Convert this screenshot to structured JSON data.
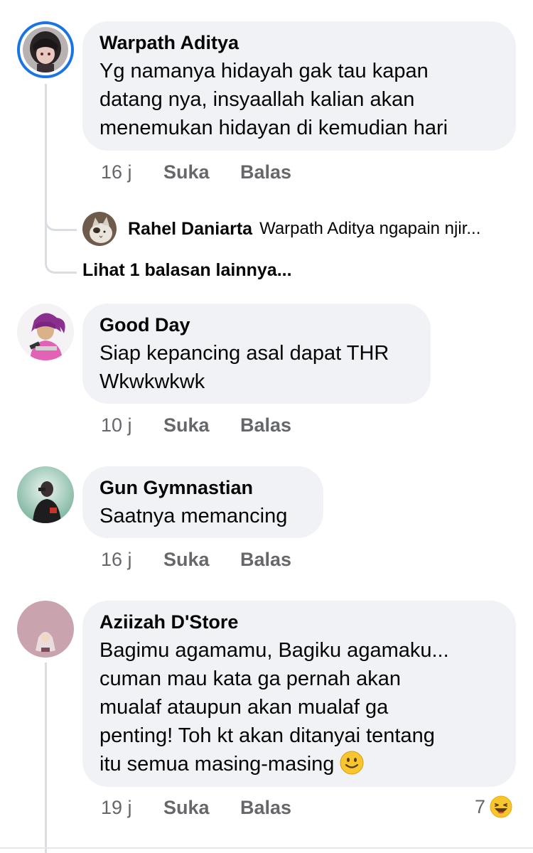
{
  "comments": [
    {
      "author": "Warpath Aditya",
      "text": "Yg namanya hidayah gak tau kapan\ndatang nya, insyaallah kalian akan\nmenemukan hidayan di kemudian hari",
      "time": "16 j",
      "like_label": "Suka",
      "reply_label": "Balas",
      "avatar_icon": "dark-anime-avatar",
      "reply_preview": {
        "author": "Rahel Daniarta",
        "text": "Warpath Aditya ngapain njir...",
        "avatar_icon": "cat-avatar"
      },
      "more_replies": "Lihat 1 balasan lainnya..."
    },
    {
      "author": "Good Day",
      "text": "Siap kepancing asal dapat THR\nWkwkwkwk",
      "time": "10 j",
      "like_label": "Suka",
      "reply_label": "Balas",
      "avatar_icon": "pink-hoodie-girl-avatar"
    },
    {
      "author": "Gun Gymnastian",
      "text": "Saatnya memancing",
      "time": "16 j",
      "like_label": "Suka",
      "reply_label": "Balas",
      "avatar_icon": "person-photo-avatar"
    },
    {
      "author": "Aziizah D'Store",
      "text": "Bagimu agamamu, Bagiku agamaku...\ncuman mau kata ga pernah akan\nmualaf ataupun akan mualaf ga\npenting! Toh kt akan ditanyai tentang\nitu semua masing-masing",
      "emoji": "slightly-smiling-face-emoji",
      "time": "19 j",
      "like_label": "Suka",
      "reply_label": "Balas",
      "avatar_icon": "hijab-girl-avatar",
      "reaction": {
        "count": "7",
        "icon": "haha-reaction-icon"
      }
    }
  ],
  "colors": {
    "bubble": "#f0f2f5",
    "meta_text": "#65676b",
    "thread_line": "#dadde1",
    "story_ring": "#1b74e4"
  }
}
